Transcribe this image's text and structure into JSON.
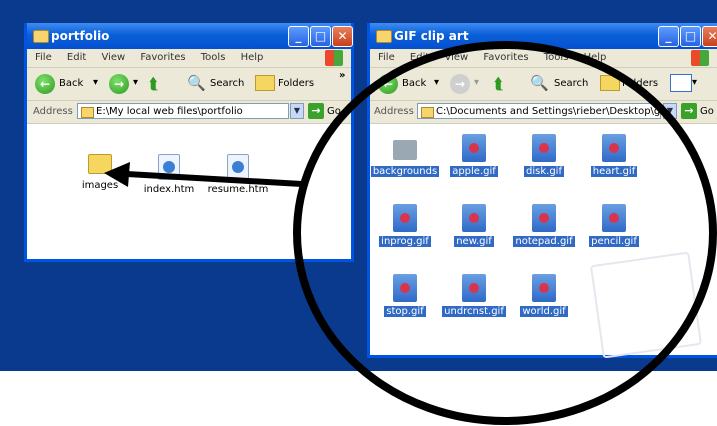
{
  "left_window": {
    "title": "portfolio",
    "menu": [
      "File",
      "Edit",
      "View",
      "Favorites",
      "Tools",
      "Help"
    ],
    "toolbar": {
      "back": "Back",
      "search": "Search",
      "folders": "Folders",
      "more": "»"
    },
    "address": {
      "label": "Address",
      "value": "E:\\My local web files\\portfolio",
      "go": "Go"
    },
    "items": [
      "images",
      "index.htm",
      "resume.htm"
    ]
  },
  "right_window": {
    "title": "GIF clip art",
    "menu": [
      "File",
      "Edit",
      "View",
      "Favorites",
      "Tools",
      "Help"
    ],
    "toolbar": {
      "back": "Back",
      "search": "Search",
      "folders": "Folders"
    },
    "address": {
      "label": "Address",
      "value": "C:\\Documents and Settings\\rieber\\Desktop\\gi",
      "go": "Go"
    },
    "items": [
      "backgrounds",
      "apple.gif",
      "disk.gif",
      "heart.gif",
      "inprog.gif",
      "new.gif",
      "notepad.gif",
      "pencil.gif",
      "stop.gif",
      "undrcnst.gif",
      "world.gif"
    ]
  },
  "colors": {
    "desktop": "#0a3a8e",
    "titlebar": "#0a5fd8",
    "selection": "#316ac5"
  }
}
